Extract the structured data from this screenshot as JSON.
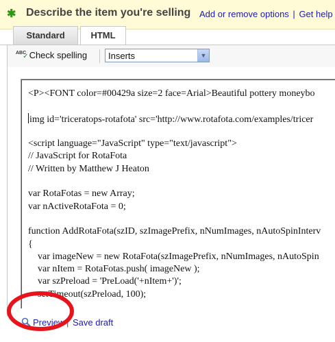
{
  "header": {
    "title": "Describe the item you're selling",
    "links": [
      "Add or remove options",
      "Get help"
    ],
    "separator": "|"
  },
  "tabs": [
    {
      "label": "Standard",
      "active": false
    },
    {
      "label": "HTML",
      "active": true
    }
  ],
  "toolbar": {
    "spell_label": "Check spelling",
    "spell_icon_text": "ABC",
    "inserts_selected": "Inserts"
  },
  "editor": {
    "lines": [
      "<P><FONT color=#00429a size=2 face=Arial>Beautiful pottery moneybo",
      "",
      "img id='triceratops-rotafota' src='http://www.rotafota.com/examples/tricer",
      "",
      "<script language=\"JavaScript\" type=\"text/javascript\">",
      "// JavaScript for RotaFota",
      "// Written by Matthew J Heaton",
      "",
      "var RotaFotas = new Array;",
      "var nActiveRotaFota = 0;",
      "",
      "function AddRotaFota(szID, szImagePrefix, nNumImages, nAutoSpinInterv",
      "{",
      "    var imageNew = new RotaFota(szImagePrefix, nNumImages, nAutoSpin",
      "    var nItem = RotaFotas.push( imageNew );",
      "    var szPreload = 'PreLoad('+nItem+')';",
      "    setTimeout(szPreload, 100);"
    ]
  },
  "footer": {
    "preview_label": "Preview",
    "separator": "|",
    "save_draft_label": "Save draft"
  },
  "colors": {
    "header_bg": "#fffbd6",
    "link": "#1a1ab5",
    "star": "#2e9a14",
    "annotation": "#e8141c"
  },
  "icons": {
    "star": "star-icon",
    "spell": "spellcheck-icon",
    "dropdown": "chevron-down-icon",
    "preview": "magnifier-icon"
  }
}
